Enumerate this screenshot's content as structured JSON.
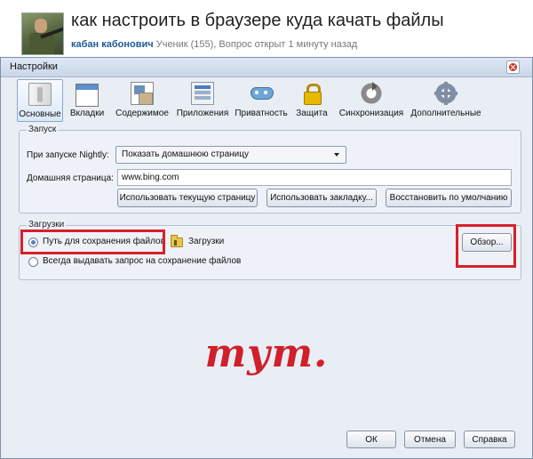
{
  "question": {
    "title": "как настроить в браузере куда качать файлы",
    "author": "кабан кабонович",
    "meta": "Ученик (155), Вопрос открыт 1 минуту назад"
  },
  "dialog": {
    "title": "Настройки",
    "toolbar": [
      {
        "label": "Основные",
        "icon": "general-switch-icon",
        "active": true
      },
      {
        "label": "Вкладки",
        "icon": "tabs-window-icon"
      },
      {
        "label": "Содержимое",
        "icon": "content-pictures-icon"
      },
      {
        "label": "Приложения",
        "icon": "applications-list-icon"
      },
      {
        "label": "Приватность",
        "icon": "privacy-mask-icon"
      },
      {
        "label": "Защита",
        "icon": "security-lock-icon"
      },
      {
        "label": "Синхронизация",
        "icon": "sync-icon"
      },
      {
        "label": "Дополнительные",
        "icon": "advanced-gear-icon"
      }
    ],
    "startup": {
      "legend": "Запуск",
      "on_start_label": "При запуске Nightly:",
      "on_start_value": "Показать домашнюю страницу",
      "home_label": "Домашняя страница:",
      "home_value": "www.bing.com",
      "btn_current": "Использовать текущую страницу",
      "btn_bookmark": "Использовать закладку...",
      "btn_default": "Восстановить по умолчанию"
    },
    "downloads": {
      "legend": "Загрузки",
      "save_path_label": "Путь для сохранения файлов",
      "folder_name": "Загрузки",
      "browse_button": "Обзор...",
      "always_ask_label": "Всегда выдавать запрос на сохранение файлов"
    },
    "annotation_text": "тут.",
    "buttons": {
      "ok": "ОК",
      "cancel": "Отмена",
      "help": "Справка"
    }
  },
  "colors": {
    "annotation_red": "#d7202a",
    "author_link": "#1f5a99"
  }
}
